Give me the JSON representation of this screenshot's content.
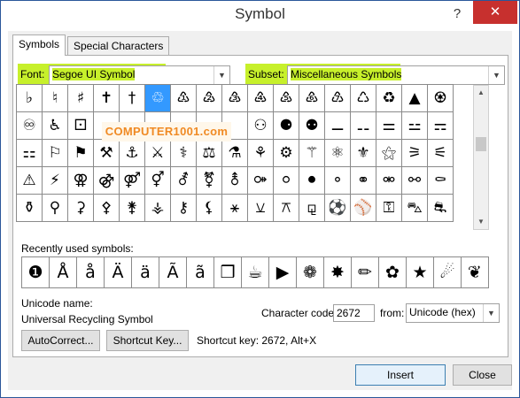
{
  "window": {
    "title": "Symbol",
    "help": "?",
    "close": "✕"
  },
  "tabs": [
    {
      "label": "Symbols"
    },
    {
      "label": "Special Characters"
    }
  ],
  "font": {
    "label": "Font:",
    "value": "Segoe UI Symbol"
  },
  "subset": {
    "label": "Subset:",
    "value": "Miscellaneous Symbols"
  },
  "grid_rows": [
    [
      "♭",
      "♮",
      "♯",
      "✝",
      "†",
      "♲",
      "♳",
      "♴",
      "♵",
      "♶",
      "♷",
      "♸",
      "♹",
      "♺",
      "♻",
      "▲",
      "♼"
    ],
    [
      "♾",
      "♿",
      "⚀",
      "",
      "",
      "",
      "",
      "",
      "",
      "⚇",
      "⚈",
      "⚉",
      "⚊",
      "⚋",
      "⚌",
      "⚍",
      "⚎"
    ],
    [
      "⚏",
      "⚐",
      "⚑",
      "⚒",
      "⚓",
      "⚔",
      "⚕",
      "⚖",
      "⚗",
      "⚘",
      "⚙",
      "⚚",
      "⚛",
      "⚜",
      "⚝",
      "⚞",
      "⚟"
    ],
    [
      "⚠",
      "⚡",
      "⚢",
      "⚣",
      "⚤",
      "⚥",
      "⚦",
      "⚧",
      "⚨",
      "⚩",
      "⚪",
      "⚫",
      "⚬",
      "⚭",
      "⚮",
      "⚯",
      "⚰"
    ],
    [
      "⚱",
      "⚲",
      "⚳",
      "⚴",
      "⚵",
      "⚶",
      "⚷",
      "⚸",
      "⚹",
      "⚺",
      "⚻",
      "⚼",
      "⚽",
      "⚾",
      "⚿",
      "⛍",
      "⛐"
    ]
  ],
  "watermark": "COMPUTER1001.com",
  "recent": {
    "label": "Recently used symbols:",
    "symbols": [
      "❶",
      "Å",
      "å",
      "Ä",
      "ä",
      "Ã",
      "ã",
      "❒",
      "☕",
      "▶",
      "❁",
      "✸",
      "✏",
      "✿",
      "★",
      "☄",
      "❦"
    ]
  },
  "unicode": {
    "label": "Unicode name:",
    "name": "Universal Recycling Symbol"
  },
  "charcode": {
    "label": "Character code:",
    "value": "2672",
    "from_label": "from:",
    "from_value": "Unicode (hex)"
  },
  "buttons": {
    "autocorrect": "AutoCorrect...",
    "shortcut_key": "Shortcut Key...",
    "insert": "Insert",
    "close": "Close"
  },
  "shortcut": {
    "text": "Shortcut key: 2672, Alt+X"
  },
  "colors": {
    "highlight": "#c7f02b",
    "selected": "#3399ff",
    "watermark": "#f08a24",
    "close": "#c7302e"
  }
}
